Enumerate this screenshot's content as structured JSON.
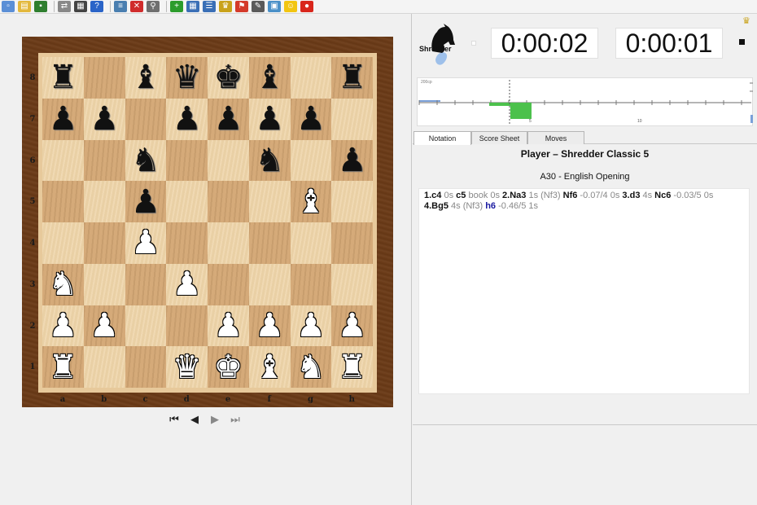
{
  "toolbar": {
    "icons": [
      {
        "name": "new-icon",
        "color": "#5b8fd6",
        "glyph": "▫"
      },
      {
        "name": "open-icon",
        "color": "#e3b83c",
        "glyph": "▤"
      },
      {
        "name": "save-icon",
        "color": "#2f7f2f",
        "glyph": "▪"
      },
      {
        "name": "swap-icon",
        "color": "#888888",
        "glyph": "⇄"
      },
      {
        "name": "board-setup-icon",
        "color": "#444444",
        "glyph": "▦"
      },
      {
        "name": "help-icon",
        "color": "#2a64c8",
        "glyph": "?"
      },
      {
        "name": "database-icon",
        "color": "#4a7fb0",
        "glyph": "≡"
      },
      {
        "name": "stop-icon",
        "color": "#d02c2c",
        "glyph": "✕"
      },
      {
        "name": "search-icon",
        "color": "#6f6f6f",
        "glyph": "⚲"
      },
      {
        "name": "add-icon",
        "color": "#2c9c2c",
        "glyph": "+"
      },
      {
        "name": "table-icon",
        "color": "#3a6fb6",
        "glyph": "▦"
      },
      {
        "name": "list-icon",
        "color": "#3a6fb6",
        "glyph": "☰"
      },
      {
        "name": "trophy-icon",
        "color": "#c9a21a",
        "glyph": "♛"
      },
      {
        "name": "flag-icon",
        "color": "#d43a2a",
        "glyph": "⚑"
      },
      {
        "name": "edit-icon",
        "color": "#5a5a5a",
        "glyph": "✎"
      },
      {
        "name": "image-icon",
        "color": "#4a90c8",
        "glyph": "▣"
      },
      {
        "name": "smiley-icon",
        "color": "#f2c511",
        "glyph": "☺"
      },
      {
        "name": "apple-icon",
        "color": "#d9261c",
        "glyph": "●"
      }
    ]
  },
  "board": {
    "rank_labels": [
      "8",
      "7",
      "6",
      "5",
      "4",
      "3",
      "2",
      "1"
    ],
    "file_labels": [
      "a",
      "b",
      "c",
      "d",
      "e",
      "f",
      "g",
      "h"
    ],
    "ranks": [
      [
        "r",
        "",
        "b",
        "q",
        "k",
        "b",
        "",
        "r"
      ],
      [
        "p",
        "p",
        "",
        "p",
        "p",
        "p",
        "p",
        ""
      ],
      [
        "",
        "",
        "n",
        "",
        "",
        "n",
        "",
        "p"
      ],
      [
        "",
        "",
        "p",
        "",
        "",
        "",
        "B",
        ""
      ],
      [
        "",
        "",
        "P",
        "",
        "",
        "",
        "",
        ""
      ],
      [
        "N",
        "",
        "",
        "P",
        "",
        "",
        "",
        ""
      ],
      [
        "P",
        "P",
        "",
        "",
        "P",
        "P",
        "P",
        "P"
      ],
      [
        "R",
        "",
        "",
        "Q",
        "K",
        "B",
        "N",
        "R"
      ]
    ],
    "light_color": "#eed4a8",
    "dark_color": "#d3a774"
  },
  "navigation": {
    "first": "⏮",
    "back": "◀",
    "forward": "▶",
    "last": "⏭"
  },
  "engine": {
    "name": "Shredder",
    "white_clock": "0:00:02",
    "black_clock": "0:00:01"
  },
  "eval_graph": {
    "top_label": "200cp",
    "tick_labels": [
      "5",
      "10"
    ],
    "bar_color": "#4cc14c"
  },
  "tabs": [
    {
      "label": "Notation",
      "active": true
    },
    {
      "label": "Score Sheet",
      "active": false
    },
    {
      "label": "Moves",
      "active": false
    }
  ],
  "game": {
    "title": "Player – Shredder Classic 5",
    "opening": "A30 - English Opening"
  },
  "notation_lines": [
    [
      {
        "t": "1.c4",
        "k": "mv"
      },
      {
        "t": " 0s ",
        "k": "ann"
      },
      {
        "t": "c5",
        "k": "mv"
      },
      {
        "t": " book 0s ",
        "k": "ann"
      },
      {
        "t": "2.Na3",
        "k": "mv"
      },
      {
        "t": " 1s (Nf3) ",
        "k": "ann"
      },
      {
        "t": "Nf6",
        "k": "mv"
      },
      {
        "t": " -0.07/4 0s ",
        "k": "ann"
      },
      {
        "t": "3.d3",
        "k": "mv"
      },
      {
        "t": " 4s ",
        "k": "ann"
      },
      {
        "t": "Nc6",
        "k": "mv"
      },
      {
        "t": " -0.03/5 0s",
        "k": "ann"
      }
    ],
    [
      {
        "t": "4.Bg5",
        "k": "mv"
      },
      {
        "t": " 4s (Nf3) ",
        "k": "ann"
      },
      {
        "t": "h6",
        "k": "mv blue"
      },
      {
        "t": " -0.46/5 1s",
        "k": "ann"
      }
    ]
  ]
}
